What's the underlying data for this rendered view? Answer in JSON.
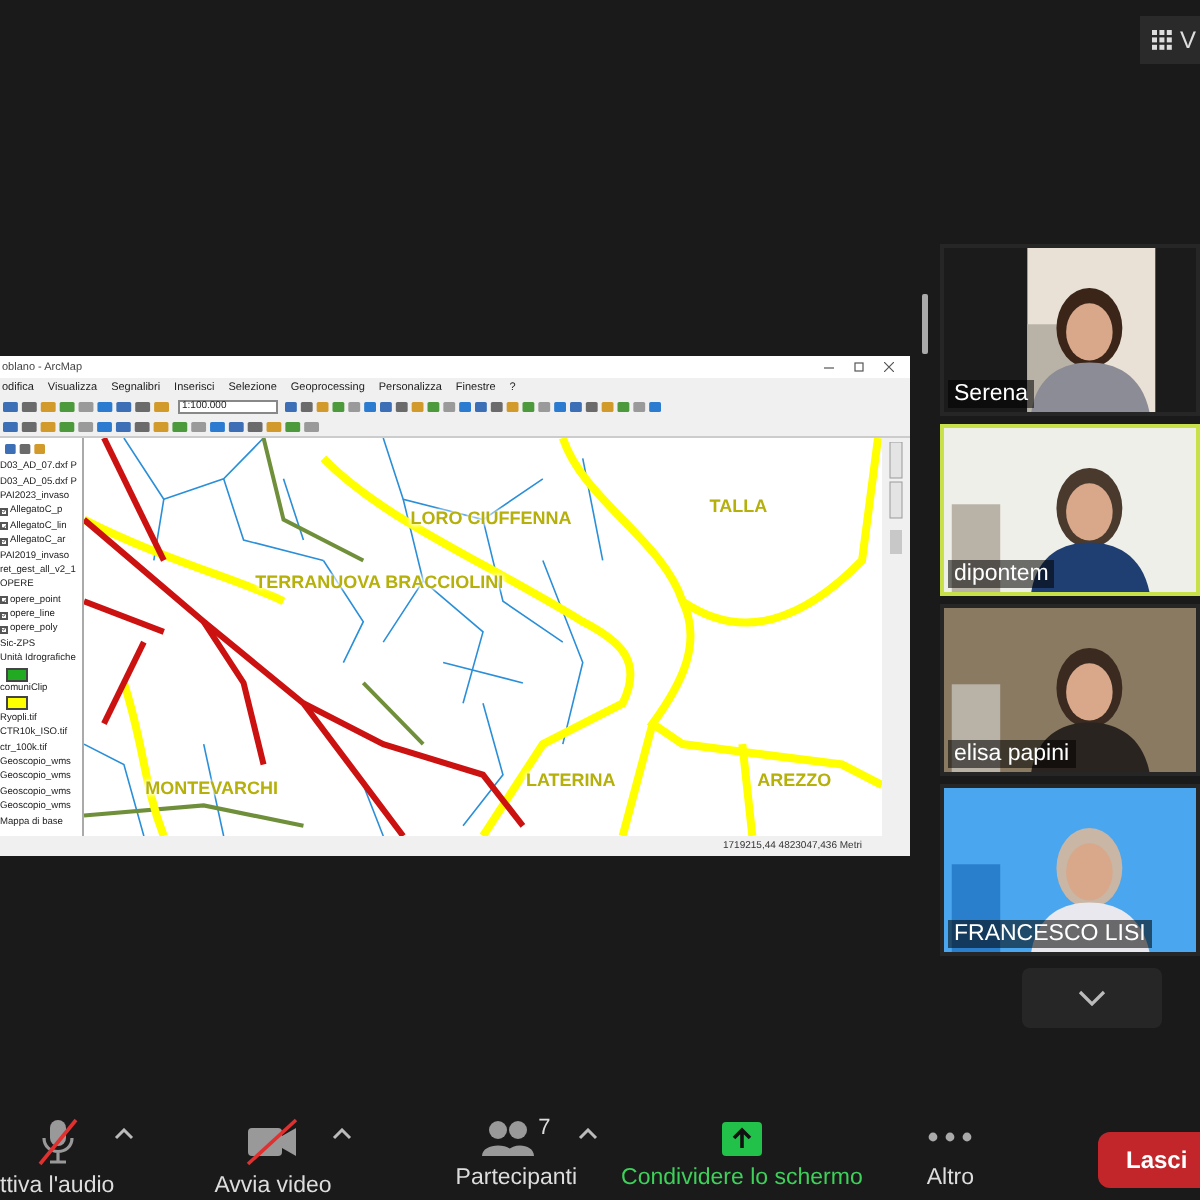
{
  "view_button": {
    "label": "V"
  },
  "shared_window": {
    "title": "oblano - ArcMap",
    "menu": [
      "odifica",
      "Visualizza",
      "Segnalibri",
      "Inserisci",
      "Selezione",
      "Geoprocessing",
      "Personalizza",
      "Finestre",
      "?"
    ],
    "scale": "1:100.000",
    "toc": [
      {
        "kind": "group",
        "label": "D03_AD_07.dxf P"
      },
      {
        "kind": "group",
        "label": "D03_AD_05.dxf P"
      },
      {
        "kind": "group",
        "label": "PAI2023_invaso"
      },
      {
        "kind": "layer",
        "label": "AllegatoC_p",
        "checked": true
      },
      {
        "kind": "layer",
        "label": "AllegatoC_lin",
        "checked": true
      },
      {
        "kind": "layer",
        "label": "AllegatoC_ar",
        "checked": true
      },
      {
        "kind": "group",
        "label": "PAI2019_invaso"
      },
      {
        "kind": "group",
        "label": "ret_gest_all_v2_1"
      },
      {
        "kind": "group",
        "label": "OPERE"
      },
      {
        "kind": "layer",
        "label": "opere_point",
        "checked": true
      },
      {
        "kind": "layer",
        "label": "opere_line",
        "checked": true
      },
      {
        "kind": "layer",
        "label": "opere_poly",
        "checked": true
      },
      {
        "kind": "group",
        "label": "Sic-ZPS"
      },
      {
        "kind": "group",
        "label": "Unità Idrografiche"
      },
      {
        "kind": "swatch",
        "color": "#22aa22"
      },
      {
        "kind": "group",
        "label": "comuniClip"
      },
      {
        "kind": "swatch",
        "color": "#ffff00"
      },
      {
        "kind": "group",
        "label": "Ryopli.tif"
      },
      {
        "kind": "group",
        "label": "CTR10k_ISO.tif"
      },
      {
        "kind": "group",
        "label": "ctr_100k.tif"
      },
      {
        "kind": "group",
        "label": "Geoscopio_wms"
      },
      {
        "kind": "group",
        "label": "Geoscopio_wms"
      },
      {
        "kind": "group",
        "label": "Geoscopio_wms"
      },
      {
        "kind": "group",
        "label": "Geoscopio_wms"
      },
      {
        "kind": "group",
        "label": "Mappa di base"
      }
    ],
    "map_labels": [
      "LORO CIUFFENNA",
      "TALLA",
      "TERRANUOVA BRACCIOLINI",
      "MONTEVARCHI",
      "LATERINA",
      "AREZZO"
    ],
    "coordinates": "1719215,44  4823047,436 Metri"
  },
  "participants": [
    {
      "name": "Serena",
      "speaking": false
    },
    {
      "name": "dipontem",
      "speaking": true
    },
    {
      "name": "elisa papini",
      "speaking": false
    },
    {
      "name": "FRANCESCO LISI",
      "speaking": false
    }
  ],
  "toolbar": [
    {
      "kind": "audio",
      "label": "ttiva l'audio",
      "muted": true,
      "menu": true
    },
    {
      "kind": "video",
      "label": "Avvia video",
      "off": true,
      "menu": true
    },
    {
      "kind": "participants",
      "label": "Partecipanti",
      "count": "7",
      "menu": true
    },
    {
      "kind": "share",
      "label": "Condividere lo schermo"
    },
    {
      "kind": "more",
      "label": "Altro"
    },
    {
      "kind": "leave",
      "label": "Lasci"
    }
  ]
}
